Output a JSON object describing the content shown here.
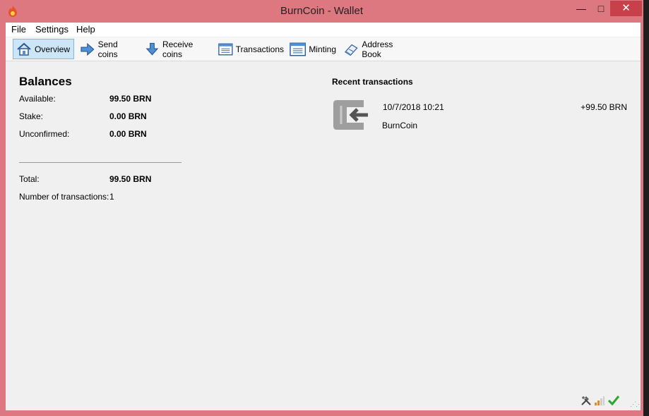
{
  "window": {
    "title": "BurnCoin - Wallet"
  },
  "controls": {
    "minimize": "—",
    "maximize": "□",
    "close": "✕"
  },
  "menu": {
    "file": "File",
    "settings": "Settings",
    "help": "Help"
  },
  "toolbar": {
    "overview": "Overview",
    "send": "Send coins",
    "receive": "Receive coins",
    "transactions": "Transactions",
    "minting": "Minting",
    "address_book": "Address Book"
  },
  "balances": {
    "title": "Balances",
    "available_label": "Available:",
    "available_value": "99.50 BRN",
    "stake_label": "Stake:",
    "stake_value": "0.00 BRN",
    "unconfirmed_label": "Unconfirmed:",
    "unconfirmed_value": "0.00 BRN",
    "total_label": "Total:",
    "total_value": "99.50 BRN",
    "tx_count_label": "Number of transactions:",
    "tx_count_value": "1"
  },
  "recent": {
    "title": "Recent transactions",
    "items": [
      {
        "date": "10/7/2018 10:21",
        "amount": "+99.50 BRN",
        "label": "BurnCoin",
        "icon": "receive-arrow-icon"
      }
    ]
  },
  "status": {
    "icons": [
      "staking-tools-icon",
      "connections-bars-icon",
      "synced-check-icon"
    ]
  },
  "colors": {
    "window_frame": "#de7880",
    "close_button": "#c7404a",
    "active_tab": "#cde6f7",
    "client_bg": "#f0f0f0"
  }
}
